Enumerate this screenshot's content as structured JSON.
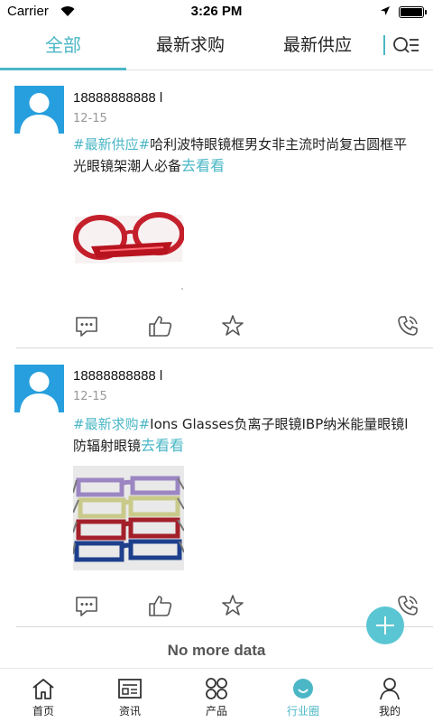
{
  "status_bar": {
    "carrier": "Carrier",
    "time": "3:26 PM"
  },
  "tabs": [
    {
      "label": "全部",
      "active": true
    },
    {
      "label": "最新求购",
      "active": false
    },
    {
      "label": "最新供应",
      "active": false
    }
  ],
  "icons": {
    "search": "search-list-icon",
    "comment": "comment-icon",
    "like": "thumbs-up-icon",
    "favorite": "star-icon",
    "phone": "phone-icon",
    "add": "plus-icon"
  },
  "colors": {
    "accent": "#4bb7c6",
    "avatar_bg": "#279fde",
    "fab": "#5bc6d3"
  },
  "posts": [
    {
      "user": "18888888888 l",
      "date": "12-15",
      "tag": "#最新供应#",
      "text": "哈利波特眼镜框男女非主流时尚复古圆框平光眼镜架潮人必备",
      "more": "去看看",
      "image": "red-round-glasses"
    },
    {
      "user": "18888888888 l",
      "date": "12-15",
      "tag": "#最新求购#",
      "text": "Ions Glasses负离子眼镜IBP纳米能量眼镜l防辐射眼镜",
      "more": "去看看",
      "image": "stacked-colored-glasses"
    }
  ],
  "footer_text": "No more data",
  "bottom_nav": [
    {
      "label": "首页",
      "icon": "home-icon",
      "active": false
    },
    {
      "label": "资讯",
      "icon": "news-icon",
      "active": false
    },
    {
      "label": "产品",
      "icon": "grid-icon",
      "active": false
    },
    {
      "label": "行业圈",
      "icon": "smile-circle-icon",
      "active": true
    },
    {
      "label": "我的",
      "icon": "user-icon",
      "active": false
    }
  ]
}
